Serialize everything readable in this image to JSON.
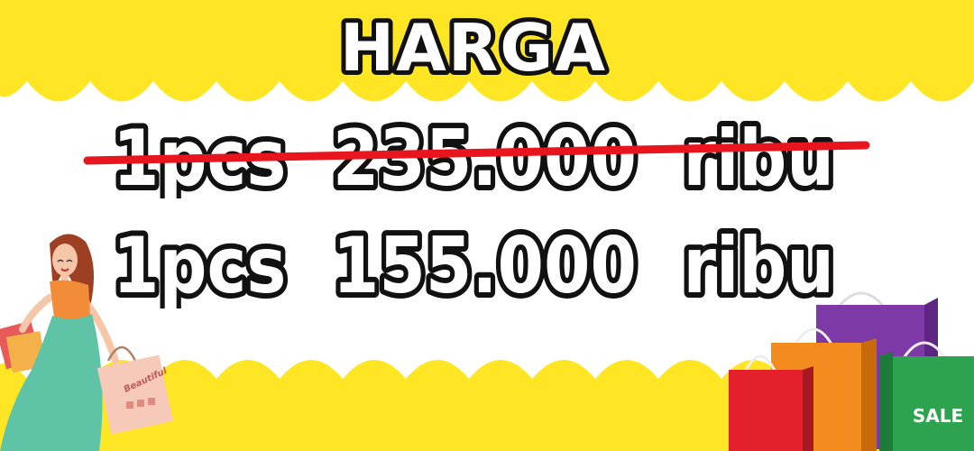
{
  "banner": {
    "title": "HARGA",
    "old_price": "1pcs  235.000  ribu",
    "new_price": "1pcs  155.000  ribu",
    "bag_label": "SALE",
    "small_bag_label": "Beautiful"
  },
  "colors": {
    "yellow": "#FFE625",
    "outline": "#111111",
    "text_fill": "#ffffff",
    "strike": "#E8141E",
    "bag_red": "#E3202B",
    "bag_orange": "#F28C1F",
    "bag_purple": "#7D3AA6",
    "bag_green": "#2EA34F"
  }
}
